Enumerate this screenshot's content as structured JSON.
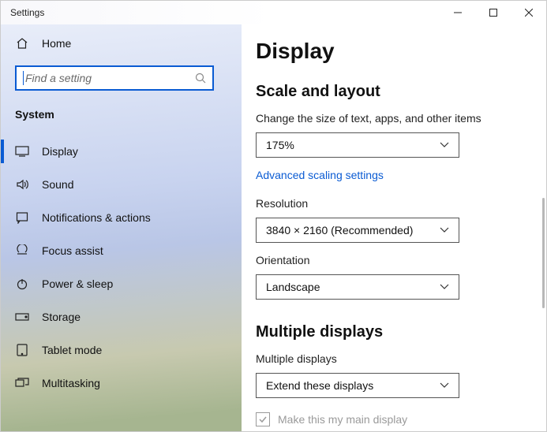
{
  "window": {
    "title": "Settings"
  },
  "sidebar": {
    "home_label": "Home",
    "search_placeholder": "Find a setting",
    "section_label": "System",
    "items": [
      {
        "label": "Display"
      },
      {
        "label": "Sound"
      },
      {
        "label": "Notifications & actions"
      },
      {
        "label": "Focus assist"
      },
      {
        "label": "Power & sleep"
      },
      {
        "label": "Storage"
      },
      {
        "label": "Tablet mode"
      },
      {
        "label": "Multitasking"
      }
    ]
  },
  "main": {
    "page_title": "Display",
    "sections": {
      "scale": {
        "heading": "Scale and layout",
        "size_label": "Change the size of text, apps, and other items",
        "size_value": "175%",
        "advanced_link": "Advanced scaling settings",
        "resolution_label": "Resolution",
        "resolution_value": "3840 × 2160 (Recommended)",
        "orientation_label": "Orientation",
        "orientation_value": "Landscape"
      },
      "multi": {
        "heading": "Multiple displays",
        "mode_label": "Multiple displays",
        "mode_value": "Extend these displays",
        "main_display_label": "Make this my main display"
      }
    }
  }
}
